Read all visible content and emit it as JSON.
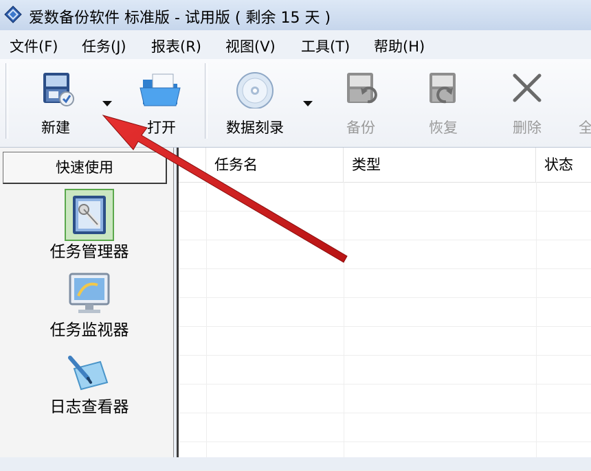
{
  "window": {
    "title": "爱数备份软件 标准版 - 试用版 ( 剩余 15 天 )"
  },
  "menu": [
    {
      "label": "文件(F)"
    },
    {
      "label": "任务(J)"
    },
    {
      "label": "报表(R)"
    },
    {
      "label": "视图(V)"
    },
    {
      "label": "工具(T)"
    },
    {
      "label": "帮助(H)"
    }
  ],
  "toolbar": {
    "new_label": "新建",
    "open_label": "打开",
    "burn_label": "数据刻录",
    "backup_label": "备份",
    "restore_label": "恢复",
    "delete_label": "删除",
    "partial_label": "全"
  },
  "quick": {
    "header": "快速使用",
    "items": [
      {
        "label": "任务管理器",
        "icon": "task-manager-icon"
      },
      {
        "label": "任务监视器",
        "icon": "monitor-icon"
      },
      {
        "label": "日志查看器",
        "icon": "log-viewer-icon"
      }
    ]
  },
  "list": {
    "columns": [
      "任务名",
      "类型",
      "状态"
    ]
  },
  "colors": {
    "annotation_arrow": "#d61f1f",
    "titlebar": "#c6d6ec"
  }
}
